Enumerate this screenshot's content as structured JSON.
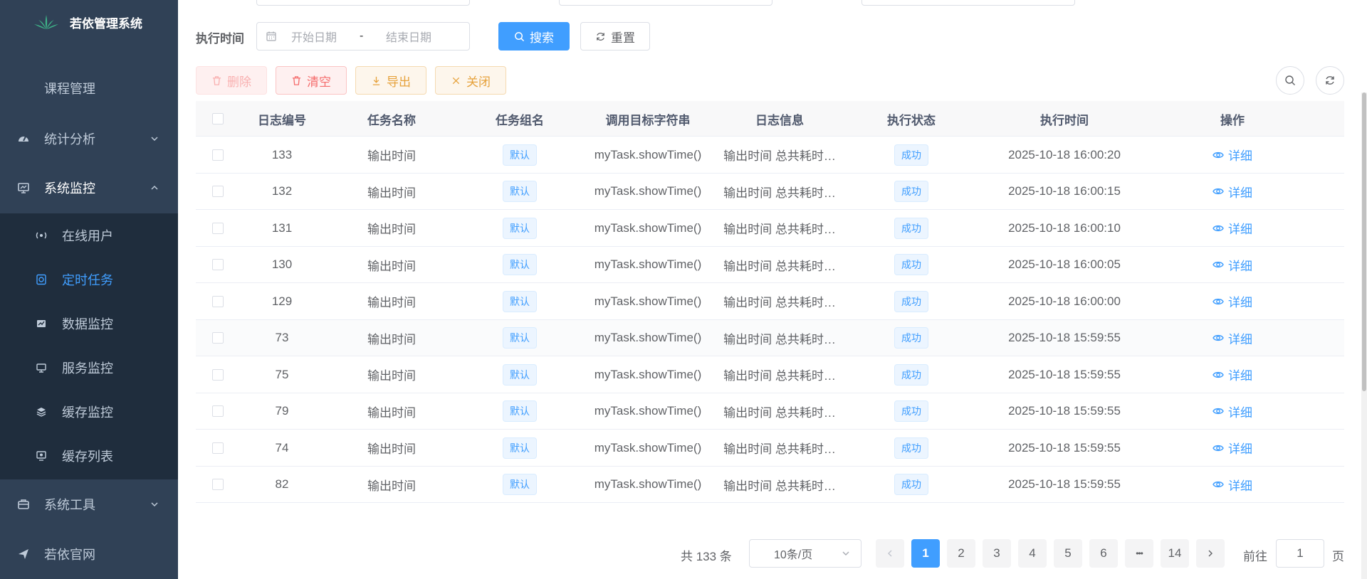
{
  "sidebar": {
    "title": "若依管理系统",
    "items": [
      {
        "label": "课程管理"
      },
      {
        "label": "统计分析"
      },
      {
        "label": "系统监控"
      },
      {
        "label": "系统工具"
      },
      {
        "label": "若依官网"
      }
    ],
    "submenu": [
      {
        "label": "在线用户"
      },
      {
        "label": "定时任务"
      },
      {
        "label": "数据监控"
      },
      {
        "label": "服务监控"
      },
      {
        "label": "缓存监控"
      },
      {
        "label": "缓存列表"
      }
    ],
    "active_submenu": "定时任务"
  },
  "search": {
    "label": "执行时间",
    "start_placeholder": "开始日期",
    "separator": "-",
    "end_placeholder": "结束日期",
    "search_label": "搜索",
    "reset_label": "重置"
  },
  "toolbar": {
    "delete_label": "删除",
    "clean_label": "清空",
    "export_label": "导出",
    "close_label": "关闭"
  },
  "table": {
    "headers": [
      "日志编号",
      "任务名称",
      "任务组名",
      "调用目标字符串",
      "日志信息",
      "执行状态",
      "执行时间",
      "操作"
    ],
    "rows": [
      {
        "id": "133",
        "name": "输出时间",
        "group": "默认",
        "target": "myTask.showTime()",
        "info": "输出时间 总共耗时…",
        "status": "成功",
        "time": "2025-10-18 16:00:20",
        "action": "详细"
      },
      {
        "id": "132",
        "name": "输出时间",
        "group": "默认",
        "target": "myTask.showTime()",
        "info": "输出时间 总共耗时…",
        "status": "成功",
        "time": "2025-10-18 16:00:15",
        "action": "详细"
      },
      {
        "id": "131",
        "name": "输出时间",
        "group": "默认",
        "target": "myTask.showTime()",
        "info": "输出时间 总共耗时…",
        "status": "成功",
        "time": "2025-10-18 16:00:10",
        "action": "详细"
      },
      {
        "id": "130",
        "name": "输出时间",
        "group": "默认",
        "target": "myTask.showTime()",
        "info": "输出时间 总共耗时…",
        "status": "成功",
        "time": "2025-10-18 16:00:05",
        "action": "详细"
      },
      {
        "id": "129",
        "name": "输出时间",
        "group": "默认",
        "target": "myTask.showTime()",
        "info": "输出时间 总共耗时…",
        "status": "成功",
        "time": "2025-10-18 16:00:00",
        "action": "详细"
      },
      {
        "id": "73",
        "name": "输出时间",
        "group": "默认",
        "target": "myTask.showTime()",
        "info": "输出时间 总共耗时…",
        "status": "成功",
        "time": "2025-10-18 15:59:55",
        "action": "详细"
      },
      {
        "id": "75",
        "name": "输出时间",
        "group": "默认",
        "target": "myTask.showTime()",
        "info": "输出时间 总共耗时…",
        "status": "成功",
        "time": "2025-10-18 15:59:55",
        "action": "详细"
      },
      {
        "id": "79",
        "name": "输出时间",
        "group": "默认",
        "target": "myTask.showTime()",
        "info": "输出时间 总共耗时…",
        "status": "成功",
        "time": "2025-10-18 15:59:55",
        "action": "详细"
      },
      {
        "id": "74",
        "name": "输出时间",
        "group": "默认",
        "target": "myTask.showTime()",
        "info": "输出时间 总共耗时…",
        "status": "成功",
        "time": "2025-10-18 15:59:55",
        "action": "详细"
      },
      {
        "id": "82",
        "name": "输出时间",
        "group": "默认",
        "target": "myTask.showTime()",
        "info": "输出时间 总共耗时…",
        "status": "成功",
        "time": "2025-10-18 15:59:55",
        "action": "详细"
      }
    ]
  },
  "pagination": {
    "total_text": "共 133 条",
    "page_size": "10条/页",
    "pages": [
      "1",
      "2",
      "3",
      "4",
      "5",
      "6",
      "14"
    ],
    "ellipsis": "•••",
    "current": "1",
    "goto_label": "前往",
    "goto_value": "1",
    "page_suffix": "页"
  },
  "colors": {
    "sidebar_bg": "#304156",
    "submenu_bg": "#1f2d3d",
    "primary": "#409eff",
    "danger": "#f56c6c",
    "warning": "#e6a23c"
  }
}
